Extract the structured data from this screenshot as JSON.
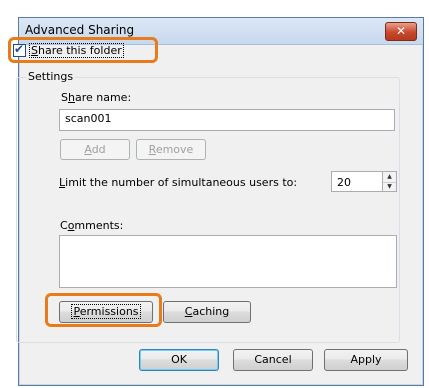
{
  "window": {
    "title": "Advanced Sharing",
    "close_glyph": "✕"
  },
  "share_folder": {
    "checked": true,
    "label_first": "S",
    "label_rest": "hare this folder"
  },
  "settings": {
    "group_label": "Settings",
    "share_name_label_pre": "S",
    "share_name_label_u": "h",
    "share_name_label_post": "are name:",
    "share_name_value": "scan001",
    "add_button_u": "A",
    "add_button_rest": "dd",
    "remove_button_u": "R",
    "remove_button_rest": "emove",
    "limit_label_u": "L",
    "limit_label_rest": "imit the number of simultaneous users to:",
    "limit_value": "20",
    "comments_label_pre": "C",
    "comments_label_u": "o",
    "comments_label_post": "mments:",
    "comments_value": "",
    "permissions_button_u": "P",
    "permissions_button_rest": "ermissions",
    "caching_button_u": "C",
    "caching_button_rest": "aching"
  },
  "footer": {
    "ok_label": "OK",
    "cancel_label": "Cancel",
    "apply_label": "Apply"
  },
  "colors": {
    "highlight": "#e87b1c",
    "window_border": "#5b7aa0",
    "close_button": "#c8482c"
  }
}
